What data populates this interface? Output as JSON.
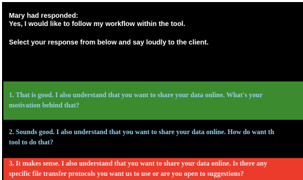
{
  "prompt": {
    "line1": "Mary had responded:",
    "line2": "Yes, I would like to follow my workflow within the tool."
  },
  "instruction": "Select your response from below and say loudly to the client.",
  "options": [
    {
      "line1": "1. That is good. I also understand that you want to share your data online. What's your",
      "line2": "motivation behind that?",
      "background": "#3d8b2f",
      "text_color": "#8fd0ee"
    },
    {
      "line1": "2. Sounds good. I also understand that you want to share your data online. How do want th",
      "line2": "tool to do that?",
      "background": "#000000",
      "text_color": "#8fd0ee"
    },
    {
      "line1": "3. It makes sense. I also understand that you want to share your data online. Is there any",
      "line2": "specific file transfer protocols you want us to use or are you open to suggestions?",
      "background": "#ec3b2b",
      "text_color": "#dfe8f0"
    }
  ]
}
